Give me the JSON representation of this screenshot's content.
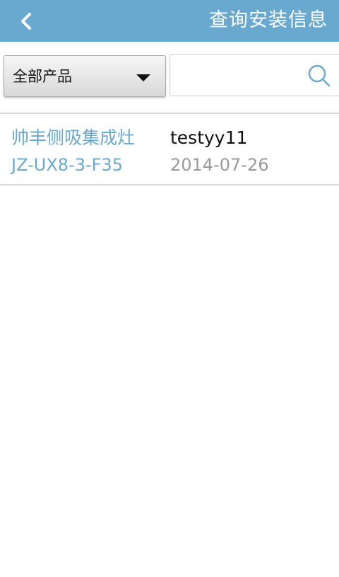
{
  "header": {
    "title": "查询安装信息",
    "back_icon": "chevron-left-icon",
    "background_color": "#6aa9cf"
  },
  "filter": {
    "product_select": {
      "selected": "全部产品",
      "icon": "caret-down-icon"
    },
    "search": {
      "value": "",
      "placeholder": "",
      "icon": "search-icon"
    }
  },
  "records": [
    {
      "product_name": "帅丰侧吸集成灶",
      "model": "JZ-UX8-3-F35",
      "user": "testyy11",
      "date": "2014-07-26"
    }
  ],
  "colors": {
    "accent": "#6aa9cf",
    "primary_text": "#111111",
    "secondary_text": "#999999",
    "divider": "#d9d9d9"
  }
}
